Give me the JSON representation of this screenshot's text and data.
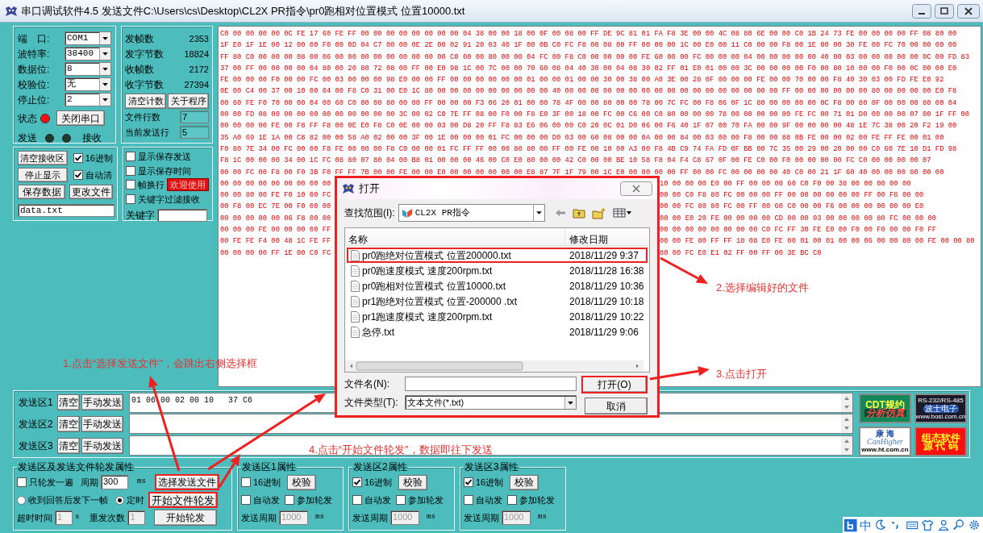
{
  "window": {
    "title": "串口调试软件4.5 发送文件C:\\Users\\cs\\Desktop\\CL2X PR指令\\pr0跑相对位置模式 位置10000.txt"
  },
  "port_settings": {
    "fields": [
      {
        "label": "端　口:",
        "value": "COM1"
      },
      {
        "label": "波特率:",
        "value": "38400"
      },
      {
        "label": "数据位:",
        "value": "8"
      },
      {
        "label": "校验位:",
        "value": "无"
      },
      {
        "label": "停止位:",
        "value": "2"
      }
    ],
    "status_label": "状态",
    "port_open": true,
    "close_port_button": "关闭串口",
    "send_label": "发送",
    "send_active": false,
    "receive_label": "接收",
    "receive_active": false
  },
  "counters": {
    "items": [
      {
        "label": "发帧数",
        "value": "2353"
      },
      {
        "label": "发字节数",
        "value": "18824"
      },
      {
        "label": "收帧数",
        "value": "2172"
      },
      {
        "label": "收字节数",
        "value": "27394"
      }
    ],
    "buttons": [
      "清空计数",
      "关于程序"
    ],
    "fields": [
      {
        "label": "文件行数",
        "value": "7"
      },
      {
        "label": "当前发送行",
        "value": "5"
      }
    ]
  },
  "receive_options": {
    "buttons": [
      "清空接收区",
      "停止显示",
      "保存数据",
      "更改文件"
    ],
    "checkboxes": [
      {
        "label": "16进制",
        "checked": true
      },
      {
        "label": "自动清",
        "checked": true
      }
    ],
    "file_field": "data.txt"
  },
  "display_options": {
    "checkboxes": [
      {
        "label": "显示保存发送",
        "checked": false
      },
      {
        "label": "显示保存时间",
        "checked": false
      },
      {
        "label": "帧换行",
        "checked": false
      },
      {
        "label": "关键字过滤接收",
        "checked": false
      }
    ],
    "badge": "欢迎使用",
    "keyword_label": "关键字"
  },
  "receive_data": {
    "lines": [
      {
        "kind": "full",
        "text": "C0 00 00 00 00 0C FE 17 60 FE FF 00 00 00 00 00 00 00 00 04 38 00 00 18 00 0F 00 08 00 FF DE 9C 81 01 FA F8 3E 00 00 4C 08 80 6E 00 00 C0 1B 24 73 FE 00 00 00 00 FF 08 80 00"
      },
      {
        "kind": "full",
        "text": "1F E0 1F 1E 00 12 00 00 F0 00 0D 04 C7 00 00 0E 2E 00 02 91 20 03 40 1F 00 0B C0 FC F8 00 08 00 FF 00 00 00 1C 00 E0 00 11 C0 00 00 F8 00 1E 00 00 30 FE 00 FC 70 00 00 00 00"
      },
      {
        "kind": "full",
        "text": "FF 80 C0 00 00 00 08 00 06 00 00 00 00 00 00 00 00 00 C0 00 00 80 00 00 04 FC 00 F8 C0 00 00 00 00 FE 60 00 00 FC 00 00 00 04 00 00 00 00 00 40 00 03 00 00 00 00 00 0C 00 FD 83"
      },
      {
        "kind": "full",
        "text": "37 00 FF 00 00 00 00 04 80 00 20 80 72 08 00 FF 00 E0 98 1C 00 7C 00 00 70 60 08 04 40 30 00 04 08 30 02 FF 01 E0 01 00 00 3C 00 00 00 00 F0 00 80 10 00 00 F0 00 0C 00 00 E0"
      },
      {
        "kind": "full",
        "text": "FE 00 00 00 F0 00 00 FC 00 03 00 00 00 98 E0 00 00 FF 00 00 00 00 00 00 01 00 00 01 00 00 30 00 38 00 A0 3E 00 28 0F 00 00 00 FE 00 00 70 00 00 F8 40 30 03 00 FD FE E0 92"
      },
      {
        "kind": "full",
        "text": "0E 00 C4 00 37 00 10 00 04 00 F8 C0 31 00 E0 1C 80 00 00 00 00 00 00 00 00 00 40 00 00 00 00 00 00 00 00 00 00 00 00 00 00 00 00 00 FF 00 00 00 00 00 00 80 00 00 00 00 E0 F8"
      },
      {
        "kind": "full",
        "text": "00 60 FE F0 70 00 00 04 00 60 C0 00 00 80 00 00 FF 00 00 00 F3 06 20 01 00 00 78 4F 00 00 80 00 00 78 00 7C FC 00 F8 06 0F 1C 80 00 00 00 00 0C F8 00 80 0F 00 00 00 80 00 04"
      },
      {
        "kind": "full",
        "text": "00 00 FD 08 00 00 00 00 00 00 00 00 00 00 3C 00 02 C0 7E FF 08 00 F0 00 F8 E0 3F 00 18 00 FC 00 C6 00 C0 80 00 00 00 78 00 00 00 00 00 FE FC 00 71 01 D0 00 00 00 07 00 1F FF 00"
      },
      {
        "kind": "full",
        "text": "00 00 00 00 FE 00 F8 FF F8 00 0E E0 F8 C0 0E 00 00 03 00 D8 20 FF F8 83 E6 06 00 00 C0 20 0C 01 D0 06 00 F6 40 1F 07 00 70 FA 00 00 9F 00 00 00 00 48 1E 7C 38 00 20 F2 19 00"
      },
      {
        "kind": "full",
        "text": "35 A0 69 1E 1A 00 C8 82 00 00 58 A0 02 00 00 3F 00 1E 00 00 00 01 FC 00 00 00 D0 03 00 60 08 00 00 0A 00 00 84 00 03 00 00 F8 00 00 88 0B FE 00 00 02 00 FE FF FE 00 01 00"
      },
      {
        "kind": "full",
        "text": "F0 80 7E 34 00 FC 00 00 F8 FE 00 00 00 F8 C0 00 00 01 FC FF FF 00 00 80 80 00 FF 00 FE 00 10 00 A3 00 F8 4B C9 74 FA FD 0F BB 00 7C 35 00 29 00 20 00 00 C0 60 7E 10 D1 FD 98"
      },
      {
        "kind": "full",
        "text": "F8 1C 00 00 00 34 00 1C FC 08 80 07 80 04 00 B8 01 00 00 00 46 00 C0 E0 80 00 00 42 C0 00 00 BE 10 58 F8 04 F4 C8 67 0F 00 FE C0 00 F0 00 00 00 00 FC C0 00 00 00 00 07"
      },
      {
        "kind": "full",
        "text": "00 00 FC 00 F8 00 F0 3B F0 FF FF 7B 00 00 FE 00 00 E0 00 00 00 00 00 00 E8 87 7F 1F 79 00 1C E0 00 00 00 00 FF 00 00 FC 00 00 00 00 40 C0 00 21 1F 60 40 00 00 00 80 00 00"
      },
      {
        "kind": "split",
        "left": "00 00 00 00 00 00 00 00 00",
        "right": "10 00 00 00 E0 00 FF 00 00 00 60 C0 F0 00 38 00 00 00 00 00"
      },
      {
        "kind": "split",
        "left": "00 00 80 00 FE F0 10 00 FC",
        "right": "00 00 C0 F8 80 FC 00 00 00 FF 00 00 00 00 00 00 FF 00 F8 00 00"
      },
      {
        "kind": "split",
        "left": "00 F8 00 EC 7E 00 F0 00 00",
        "right": "00 00 FC 80 80 FC 00 FF 00 60 C0 00 00 F6 00 00 00 00 00 00 E0"
      },
      {
        "kind": "split",
        "left": "00 00 00 00 00 06 F8 00 00",
        "right": "00 00 E0 20 FE 00 00 00 00 CD 00 00 03 00 00 00 00 80 FC 00 00 00"
      },
      {
        "kind": "split",
        "left": "00 00 00 FE 00 00 00 00 FF",
        "right": "00 00 00 00 00 00 00 00 C0 FC FF 30 FE E0 00 F0 00 F0 00 00 F0 FF"
      },
      {
        "kind": "split",
        "left": "00 FE FE F4 00 48 1C FE FF",
        "right": "00 00 FE 80 FF FF 18 08 E0 FE 00 01 00 01 00 00 06 00 00 80 00 FE 00 00 80"
      },
      {
        "kind": "split",
        "left": "00 00 00 00 FF 1E 00 C0 FC",
        "right": "80 00 FC E0 E1 02 FF 00 FF 00 3E BC C0"
      }
    ]
  },
  "open_dialog": {
    "title": "打开",
    "look_in_label": "查找范围(I):",
    "look_in_value": "CL2X PR指令",
    "columns": [
      "名称",
      "修改日期"
    ],
    "files": [
      {
        "name": "pr0跑绝对位置模式 位置200000.txt",
        "modified": "2018/11/29 9:37",
        "selected": true
      },
      {
        "name": "pr0跑速度模式 速度200rpm.txt",
        "modified": "2018/11/28 16:38",
        "selected": false
      },
      {
        "name": "pr0跑相对位置模式 位置10000.txt",
        "modified": "2018/11/29 10:36",
        "selected": false
      },
      {
        "name": "pr1跑绝对位置模式 位置-200000 .txt",
        "modified": "2018/11/29 10:18",
        "selected": false
      },
      {
        "name": "pr1跑速度模式 速度200rpm.txt",
        "modified": "2018/11/29 10:22",
        "selected": false
      },
      {
        "name": "急停.txt",
        "modified": "2018/11/29 9:06",
        "selected": false
      }
    ],
    "file_name_label": "文件名(N):",
    "file_type_label": "文件类型(T):",
    "file_type_value": "文本文件(*.txt)",
    "open_button": "打开(O)",
    "cancel_button": "取消"
  },
  "send_zones": [
    {
      "label": "发送区1",
      "clear_button": "清空",
      "send_button": "手动发送",
      "value": "01 06 00 02 00 10   37 C6"
    },
    {
      "label": "发送区2",
      "clear_button": "清空",
      "send_button": "手动发送"
    },
    {
      "label": "发送区3",
      "clear_button": "清空",
      "send_button": "手动发送"
    }
  ],
  "ads": [
    {
      "kind": "cdt",
      "lines": [
        "CDT规约",
        "分析仿真"
      ]
    },
    {
      "kind": "bosi",
      "lines": [
        "RS-232/RS-485",
        "波士电子",
        "www.bosi.com.cn"
      ]
    },
    {
      "kind": "canhigher",
      "lines": [
        "康 海",
        "CanHigher",
        "www.ht.com.cn"
      ]
    },
    {
      "kind": "source",
      "lines": [
        "组态软件",
        "源 代 码"
      ]
    }
  ],
  "send_file_settings": {
    "title": "发送区及发送文件轮发属性",
    "once": {
      "label": "只轮发一遍",
      "checked": false
    },
    "period_label": "周期",
    "period_value": "300",
    "period_unit": "ms",
    "select_file_button": "选择发送文件",
    "modes": [
      {
        "label": "收到回答后发下一帧",
        "selected": false
      },
      {
        "label": "定时",
        "selected": true
      }
    ],
    "start_file_button": "开始文件轮发",
    "timeout_label": "超时时间",
    "timeout_value": "1",
    "timeout_unit": "s",
    "retry_label": "重发次数",
    "retry_value": "1",
    "start_button": "开始轮发"
  },
  "zone_settings": [
    {
      "title": "发送区1属性",
      "hex": {
        "label": "16进制",
        "checked": false
      },
      "check_button": "校验",
      "auto": {
        "label": "自动发",
        "checked": false
      },
      "rotate": {
        "label": "参加轮发",
        "checked": false
      },
      "period_label": "发送周期",
      "period_value": "1000",
      "period_unit": "ms"
    },
    {
      "title": "发送区2属性",
      "hex": {
        "label": "16进制",
        "checked": true
      },
      "check_button": "校验",
      "auto": {
        "label": "自动发",
        "checked": false
      },
      "rotate": {
        "label": "参加轮发",
        "checked": false
      },
      "period_label": "发送周期",
      "period_value": "1000",
      "period_unit": "ms"
    },
    {
      "title": "发送区3属性",
      "hex": {
        "label": "16进制",
        "checked": true
      },
      "check_button": "校验",
      "auto": {
        "label": "自动发",
        "checked": false
      },
      "rotate": {
        "label": "参加轮发",
        "checked": false
      },
      "period_label": "发送周期",
      "period_value": "1000",
      "period_unit": "ms"
    }
  ],
  "annotations": [
    {
      "text": "1.点击“选择发送文件”，会跳出右侧选择框"
    },
    {
      "text": "2.选择编辑好的文件"
    },
    {
      "text": "3.点击打开"
    },
    {
      "text": "4.点击“开始文件轮发”，数据即往下发送"
    }
  ],
  "ime_bar": {
    "language": "中"
  }
}
